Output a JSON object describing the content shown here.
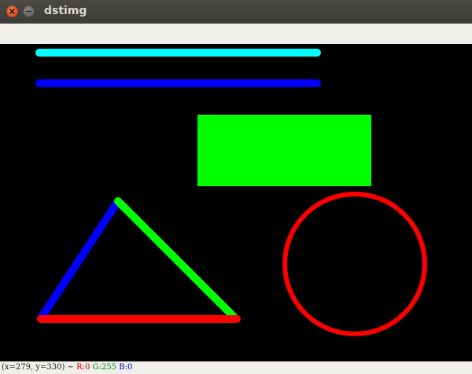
{
  "window": {
    "title": "dstimg"
  },
  "canvas": {
    "background": "#000000",
    "shapes": [
      {
        "name": "cyan-line",
        "color": "#00ffff"
      },
      {
        "name": "blue-line",
        "color": "#0000ff"
      },
      {
        "name": "green-rectangle",
        "color": "#00ff00"
      },
      {
        "name": "red-circle",
        "color": "#ff0000"
      },
      {
        "name": "triangle-blue-edge",
        "color": "#0000ff"
      },
      {
        "name": "triangle-green-edge",
        "color": "#00ff00"
      },
      {
        "name": "triangle-red-edge",
        "color": "#ff0000"
      }
    ]
  },
  "status": {
    "coords": "(x=279, y=330) ~",
    "r": "R:0",
    "g": "G:255",
    "b": "B:0"
  }
}
